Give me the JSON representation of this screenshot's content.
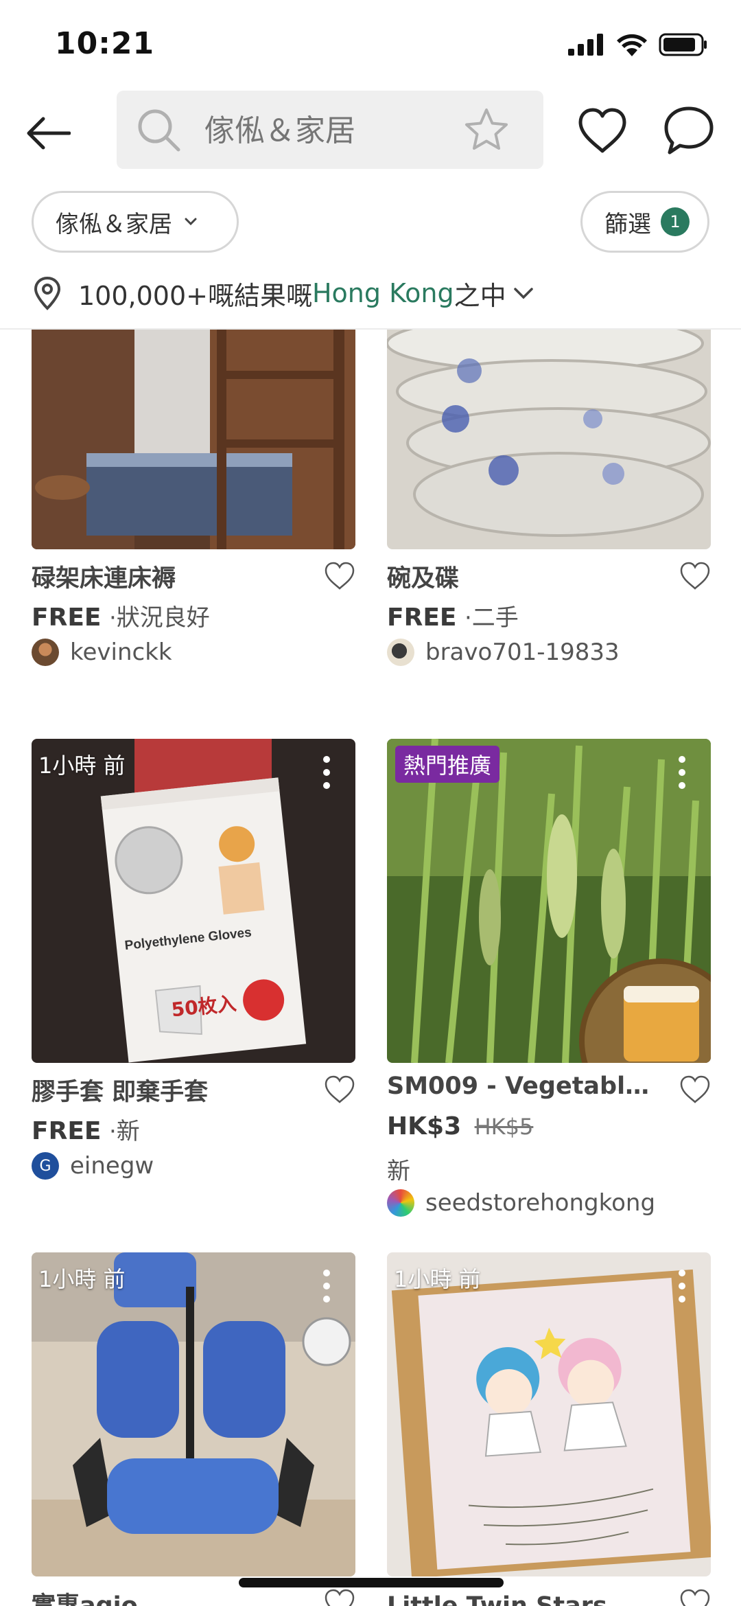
{
  "status_bar": {
    "time": "10:21"
  },
  "header": {
    "search_placeholder": "傢俬＆家居"
  },
  "filters": {
    "category_label": "傢俬＆家居",
    "filter_label": "篩選",
    "filter_count": "1"
  },
  "location": {
    "prefix": "100,000+嘅結果嘅",
    "place": "Hong Kong",
    "suffix": "之中"
  },
  "listings": [
    {
      "title": "碌架床連床褥",
      "price": "FREE",
      "condition": "·狀況良好",
      "seller": "kevinckk"
    },
    {
      "title": "碗及碟",
      "price": "FREE",
      "condition": "·二手",
      "seller": "bravo701-19833"
    },
    {
      "time": "1小時 前",
      "title": "膠手套 即棄手套",
      "price": "FREE",
      "condition": "·新",
      "seller": "einegw",
      "avatar_letter": "G"
    },
    {
      "tag": "熱門推廣",
      "title": "SM009 - Vegetable S...",
      "price": "HK$3",
      "was_price": "HK$5",
      "condition": "新",
      "seller": "seedstorehongkong"
    },
    {
      "time": "1小時 前",
      "title": "實惠agio"
    },
    {
      "time": "1小時 前",
      "title": "Little Twin Stars 木盒"
    }
  ],
  "image_text": {
    "gloves_label": "Polyethylene Gloves",
    "gloves_count": "50枚入"
  },
  "colors": {
    "accent_green": "#2a7a5f",
    "promo_purple": "#7a2aa0",
    "search_bg": "#efefef"
  }
}
